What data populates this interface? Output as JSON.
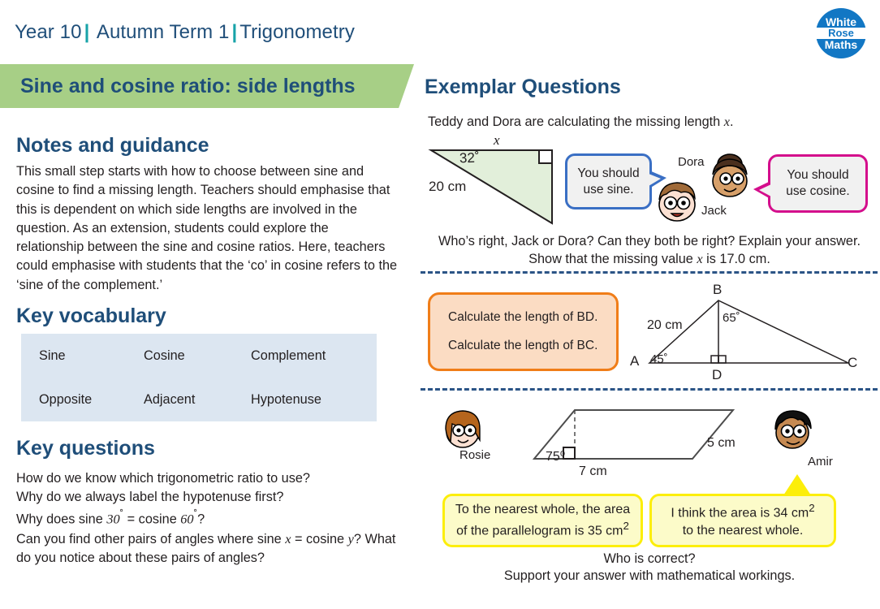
{
  "header": {
    "breadcrumb": [
      "Year 10",
      "Autumn Term 1",
      "Trigonometry"
    ],
    "separator": "|",
    "logo": {
      "line1": "White",
      "line2": "Rose",
      "line3": "Maths"
    }
  },
  "title_banner": {
    "text": "Sine and cosine ratio: side lengths",
    "background": "#a7cf86",
    "text_color": "#1f4e79"
  },
  "left": {
    "notes": {
      "heading": "Notes and guidance",
      "body": "This small step starts with how to choose between sine and cosine to find a missing length. Teachers should emphasise that this is dependent on which side lengths are involved in the question. As an extension, students could explore the relationship between the sine and cosine ratios. Here, teachers could emphasise with students that the ‘co’ in cosine refers to the ‘sine of the complement.’"
    },
    "vocabulary": {
      "heading": "Key vocabulary",
      "background": "#dce6f1",
      "terms": [
        "Sine",
        "Cosine",
        "Complement",
        "Opposite",
        "Adjacent",
        "Hypotenuse"
      ]
    },
    "key_questions": {
      "heading": "Key questions",
      "lines": [
        "How do we know which trigonometric ratio to use?",
        "Why do we always label the hypotenuse first?",
        "Why does sine 30˚ = cosine 60˚?",
        "Can you find other pairs of angles where sine x = cosine y? What do you notice about these pairs of angles?"
      ],
      "q3_prefix": "Why does sine ",
      "q3_a": "30",
      "q3_mid": " = cosine ",
      "q3_b": "60",
      "q3_suffix": "?",
      "q4_prefix": "Can you find other pairs of angles where sine ",
      "q4_x": "x",
      "q4_mid": " = cosine ",
      "q4_y": "y",
      "q4_suffix": "? What do you notice about these pairs of angles?"
    }
  },
  "right": {
    "heading": "Exemplar Questions",
    "q1": {
      "intro_before": "Teddy and Dora are calculating the missing length ",
      "intro_var": "x",
      "intro_after": ".",
      "triangle": {
        "top_label": "x",
        "angle": "32˚",
        "side": "20 cm",
        "fill": "#e2efda",
        "right_angle": "right-angle-marker"
      },
      "bubble_sine": {
        "line1": "You should",
        "line2": "use sine.",
        "border": "#3a6fc4"
      },
      "bubble_cosine": {
        "line1": "You should",
        "line2": "use cosine.",
        "border": "#d40e8c"
      },
      "avatar_dora": "Dora",
      "avatar_jack": "Jack",
      "outro_line1": "Who’s right, Jack or Dora? Can they both be right? Explain your answer.",
      "outro_line2_before": "Show that the missing value ",
      "outro_line2_var": "x",
      "outro_line2_after": " is 17.0 cm."
    },
    "q2": {
      "box": {
        "line1": "Calculate the length of BD.",
        "line2": "Calculate the length of BC.",
        "fill": "#fbdcc3",
        "border": "#f07d18"
      },
      "diagram": {
        "vertex_a": "A",
        "vertex_b": "B",
        "vertex_c": "C",
        "vertex_d": "D",
        "side_ab": "20 cm",
        "angle_a": "45˚",
        "angle_dbc": "65˚",
        "right_angle_at": "D"
      }
    },
    "q3": {
      "parallelogram": {
        "angle": "75⁰",
        "base": "7 cm",
        "side": "5 cm"
      },
      "avatar_rosie": "Rosie",
      "avatar_amir": "Amir",
      "bubble_rosie": {
        "line1": "To the nearest whole, the area",
        "line2_before": "of the parallelogram is 35 cm",
        "line2_sup": "2"
      },
      "bubble_amir": {
        "line1_before": "I think the area is 34 cm",
        "line1_sup": "2",
        "line2": "to the nearest whole."
      },
      "outro_line1": "Who is correct?",
      "outro_line2": "Support your answer with mathematical workings."
    }
  },
  "colors": {
    "navy": "#1f4e79",
    "teal": "#18a3a8",
    "green": "#a7cf86",
    "divider": "#2b5486",
    "yellow_fill": "#fcfbc9",
    "yellow_border": "#fcee0a"
  }
}
